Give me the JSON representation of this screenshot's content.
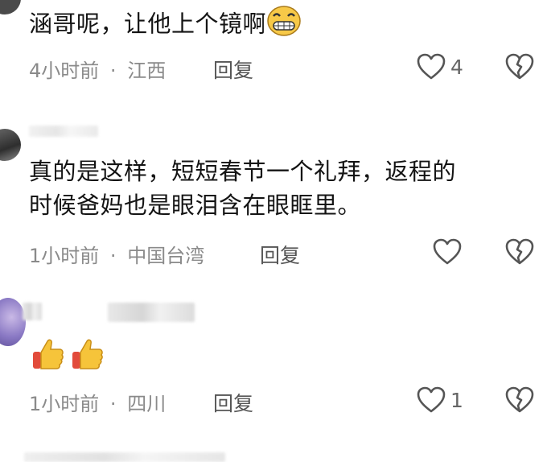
{
  "comments": [
    {
      "text": "涵哥呢，让他上个镜啊",
      "time": "4小时前",
      "location": "江西",
      "reply_label": "回复",
      "like_count": "4"
    },
    {
      "username": "…",
      "text_line1": "真的是这样，短短春节一个礼拜，返程的",
      "text_line2": "时候爸妈也是眼泪含在眼眶里。",
      "time": "1小时前",
      "location": "中国台湾",
      "reply_label": "回复",
      "like_count": ""
    },
    {
      "time": "1小时前",
      "location": "四川",
      "reply_label": "回复",
      "like_count": "1"
    }
  ],
  "meta_separator": "·",
  "icons": {
    "like": "heart-outline-icon",
    "dislike": "broken-heart-icon",
    "grin": "grinning-face-emoji",
    "thumbs_up": "thumbs-up-emoji"
  },
  "colors": {
    "meta_text": "#8a8a8a",
    "icon_stroke": "#555555"
  }
}
